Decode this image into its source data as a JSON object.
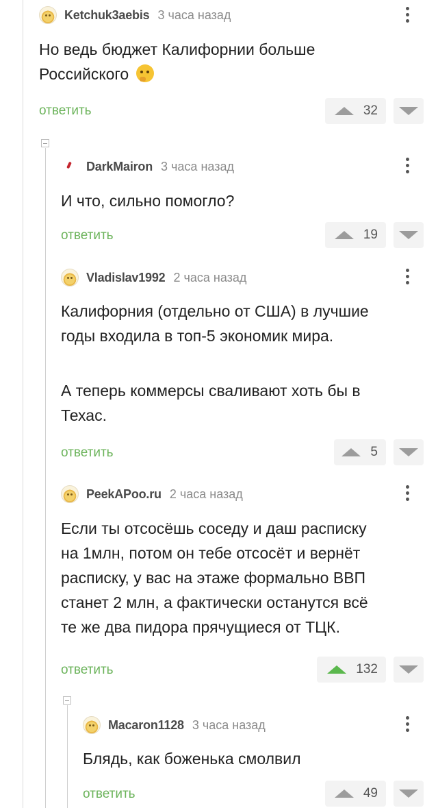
{
  "comments": [
    {
      "author": "Ketchuk3aebis",
      "time": "3 часа назад",
      "text_lines": [
        "Но ведь бюджет Калифорнии больше",
        "Российского"
      ],
      "emoji": "thinking-face",
      "reply_label": "ответить",
      "votes": "32"
    },
    {
      "author": "DarkMairon",
      "time": "3 часа назад",
      "text_lines": [
        "И что, сильно помогло?"
      ],
      "reply_label": "ответить",
      "votes": "19"
    },
    {
      "author": "Vladislav1992",
      "time": "2 часа назад",
      "text_lines": [
        "Калифорния (отдельно от США) в лучшие",
        "годы входила в топ-5 экономик мира.",
        "",
        "А теперь коммерсы сваливают хоть бы в",
        "Техас."
      ],
      "reply_label": "ответить",
      "votes": "5"
    },
    {
      "author": "PeekAPoo.ru",
      "time": "2 часа назад",
      "text_lines": [
        "Если ты отсосёшь соседу и даш расписку",
        "на 1млн, потом он тебе отсосёт и вернёт",
        "расписку, у вас на этаже формально ВВП",
        "станет 2 млн, а фактически останутся всё",
        "те же два пидора прячущиеся от ТЦК."
      ],
      "reply_label": "ответить",
      "votes": "132",
      "upvoted": true,
      "upvote_color": "#5bb84d"
    },
    {
      "author": "Macaron1128",
      "time": "3 часа назад",
      "text_lines": [
        "Блядь, как боженька смолвил"
      ],
      "reply_label": "ответить",
      "votes": "49"
    }
  ],
  "colors": {
    "reply": "#6bb35a",
    "upvote_active": "#5bb84d",
    "vote_bg": "#f3f3f3"
  }
}
